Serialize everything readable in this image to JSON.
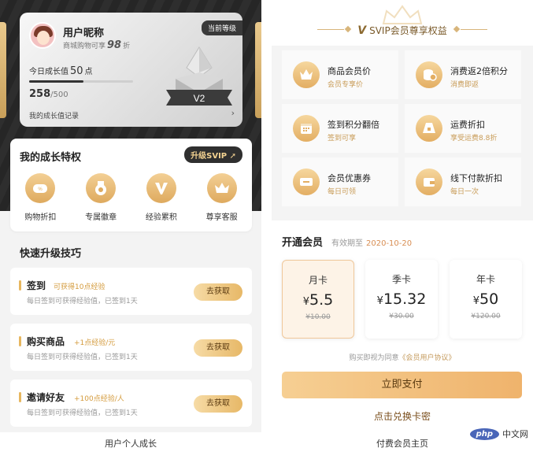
{
  "left": {
    "card": {
      "level_tag": "当前等级",
      "nickname": "用户昵称",
      "discount_prefix": "商城购物可享",
      "discount_value": "98",
      "discount_suffix": "折",
      "today_prefix": "今日成长值",
      "today_value": "50",
      "today_suffix": "点",
      "score_current": "258",
      "score_total": "/500",
      "progress_fraction": 0.52,
      "record_label": "我的成长值记录",
      "level_badge": "V2"
    },
    "privilege": {
      "title": "我的成长特权",
      "upgrade_label": "升级SVIP",
      "items": [
        {
          "label": "购物折扣",
          "icon": "discount-tag-icon"
        },
        {
          "label": "专属徽章",
          "icon": "medal-icon"
        },
        {
          "label": "经验累积",
          "icon": "vip-icon"
        },
        {
          "label": "尊享客服",
          "icon": "crown-icon"
        }
      ]
    },
    "quick_title": "快速升级技巧",
    "tasks": [
      {
        "name": "签到",
        "reward": "可获得10点经验",
        "desc": "每日签到可获得经验值，已签到1天",
        "button": "去获取"
      },
      {
        "name": "购买商品",
        "reward": "+1点经验/元",
        "desc": "每日签到可获得经验值，已签到1天",
        "button": "去获取"
      },
      {
        "name": "邀请好友",
        "reward": "+100点经验/人",
        "desc": "每日签到可获得经验值，已签到1天",
        "button": "去获取"
      }
    ],
    "caption": "用户个人成长"
  },
  "right": {
    "header": {
      "logo": "V",
      "title": "SVIP会员尊享权益"
    },
    "benefits": [
      {
        "title": "商品会员价",
        "sub": "会员专享价",
        "icon": "crown-icon"
      },
      {
        "title": "消费返2倍积分",
        "sub": "消费即返",
        "icon": "coins-icon"
      },
      {
        "title": "签到积分翻倍",
        "sub": "签到可享",
        "icon": "calendar-icon"
      },
      {
        "title": "运费折扣",
        "sub": "享受运费8.8折",
        "icon": "package-icon"
      },
      {
        "title": "会员优惠券",
        "sub": "每日可领",
        "icon": "coupon-icon"
      },
      {
        "title": "线下付款折扣",
        "sub": "每日一次",
        "icon": "wallet-icon"
      }
    ],
    "open_title": "开通会员",
    "valid_label": "有效期至",
    "valid_date": "2020-10-20",
    "plans": [
      {
        "name": "月卡",
        "currency": "¥",
        "price": "5.5",
        "original": "¥10.00",
        "selected": true
      },
      {
        "name": "季卡",
        "currency": "¥",
        "price": "15.32",
        "original": "¥30.00",
        "selected": false
      },
      {
        "name": "年卡",
        "currency": "¥",
        "price": "50",
        "original": "¥120.00",
        "selected": false
      }
    ],
    "agree_prefix": "购买即视为同意",
    "agree_link": "《会员用户协议》",
    "pay_button": "立即支付",
    "redeem_link": "点击兑换卡密",
    "caption": "付费会员主页"
  },
  "watermark": {
    "logo": "php",
    "text": "中文网"
  },
  "colors": {
    "gold": "#e7b760",
    "dark": "#2f2f2f",
    "accent_text": "#d49b3d"
  }
}
